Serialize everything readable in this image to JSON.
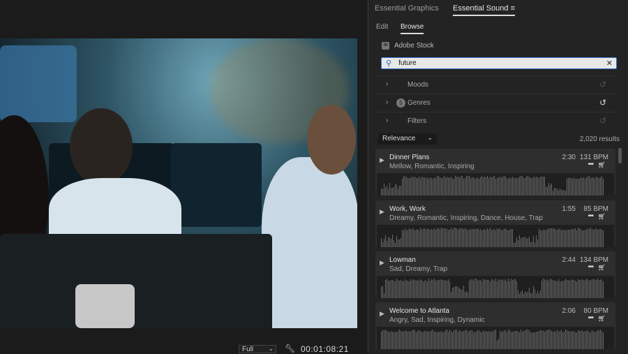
{
  "monitor": {
    "quality": "Full",
    "timecode": "00:01:08:21"
  },
  "panel": {
    "tabs": [
      {
        "label": "Essential Graphics"
      },
      {
        "label": "Essential Sound"
      }
    ],
    "menu_icon": "hamburger-icon",
    "subtabs": [
      {
        "label": "Edit"
      },
      {
        "label": "Browse"
      }
    ],
    "source": {
      "badge": "St",
      "label": "Adobe Stock"
    },
    "search": {
      "value": "future"
    },
    "filters": [
      {
        "label": "Moods"
      },
      {
        "label": "Genres",
        "badge": "5"
      },
      {
        "label": "Filters"
      }
    ],
    "sort": "Relevance",
    "results": "2,020 results",
    "tracks": [
      {
        "title": "Dinner Plans",
        "tags": "Mellow, Romantic, Inspiring",
        "duration": "2:30",
        "bpm": "131 BPM"
      },
      {
        "title": "Work, Work",
        "tags": "Dreamy, Romantic, Inspiring, Dance, House, Trap",
        "duration": "1:55",
        "bpm": "85 BPM"
      },
      {
        "title": "Lowman",
        "tags": "Sad, Dreamy, Trap",
        "duration": "2:44",
        "bpm": "134 BPM"
      },
      {
        "title": "Welcome to Atlanta",
        "tags": "Angry, Sad, Inspiring, Dynamic",
        "duration": "2:06",
        "bpm": "80 BPM"
      }
    ]
  }
}
